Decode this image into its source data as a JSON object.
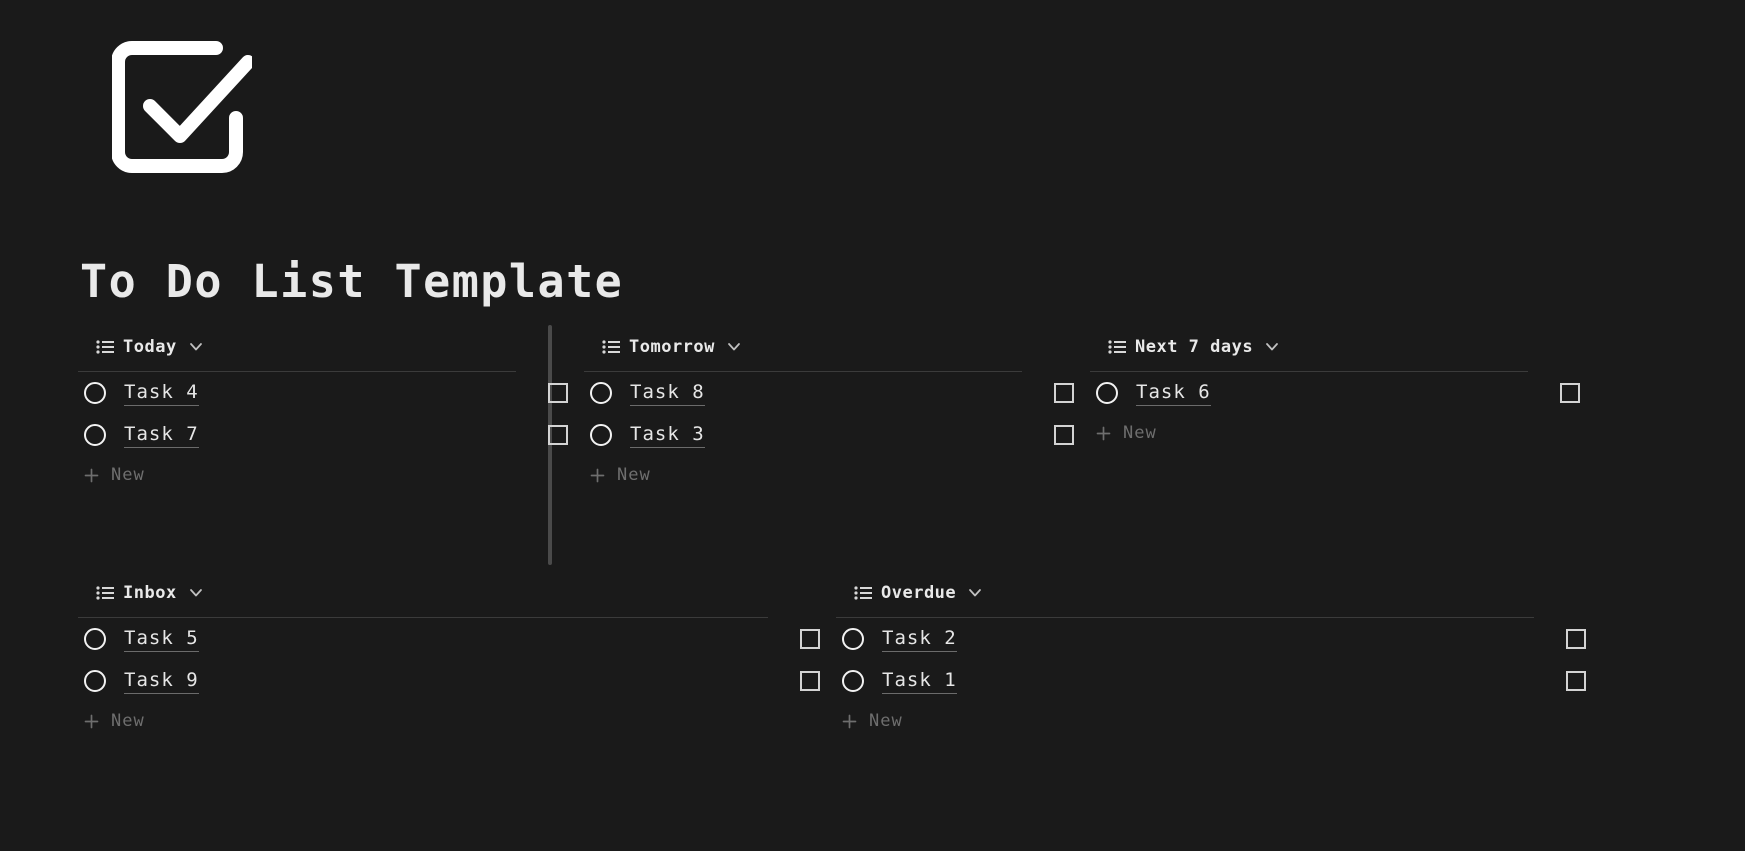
{
  "page": {
    "background_color": "#1a1a1a",
    "logo_icon": "checkbox-check-icon",
    "title": "To Do List Template"
  },
  "icons": {
    "list": "list-icon",
    "chevron_down": "chevron-down-icon",
    "plus": "plus-icon",
    "circle": "circle-status-icon",
    "checkbox": "checkbox-icon"
  },
  "labels": {
    "new": "New"
  },
  "colors": {
    "background": "#1a1a1a",
    "text": "#e9e9e9",
    "muted_text": "#6e6e6e",
    "rule": "#3b3b3b",
    "divider": "#4a4a4a",
    "underline": "#6b6b6b"
  },
  "sections": [
    {
      "title": "Today",
      "tasks": [
        {
          "name": "Task 4",
          "done": false
        },
        {
          "name": "Task 7",
          "done": false
        }
      ],
      "new_label": "New"
    },
    {
      "title": "Tomorrow",
      "tasks": [
        {
          "name": "Task 8",
          "done": false
        },
        {
          "name": "Task 3",
          "done": false
        }
      ],
      "new_label": "New"
    },
    {
      "title": "Next 7 days",
      "tasks": [
        {
          "name": "Task 6",
          "done": false
        }
      ],
      "new_label": "New"
    },
    {
      "title": "Inbox",
      "tasks": [
        {
          "name": "Task 5",
          "done": false
        },
        {
          "name": "Task 9",
          "done": false
        }
      ],
      "new_label": "New"
    },
    {
      "title": "Overdue",
      "tasks": [
        {
          "name": "Task 2",
          "done": false
        },
        {
          "name": "Task 1",
          "done": false
        }
      ],
      "new_label": "New"
    }
  ]
}
